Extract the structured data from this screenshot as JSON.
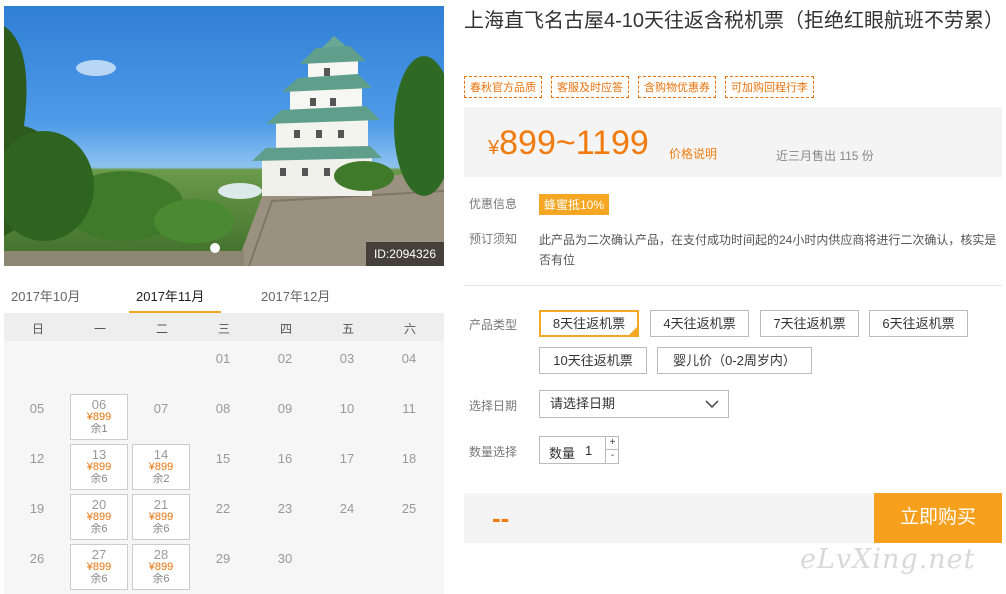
{
  "photo": {
    "id_label": "ID:2094326",
    "alt": "castle-photo"
  },
  "calendar": {
    "months": [
      "2017年10月",
      "2017年11月",
      "2017年12月"
    ],
    "weekdays": [
      "日",
      "一",
      "二",
      "三",
      "四",
      "五",
      "六"
    ],
    "plain_days": [
      "01",
      "02",
      "03",
      "04",
      "05",
      "07",
      "08",
      "09",
      "10",
      "11",
      "12",
      "15",
      "16",
      "17",
      "18",
      "19",
      "22",
      "23",
      "24",
      "25",
      "26",
      "29",
      "30"
    ],
    "available": [
      {
        "day": "06",
        "price": "¥899",
        "stock": "余1"
      },
      {
        "day": "13",
        "price": "¥899",
        "stock": "余6"
      },
      {
        "day": "14",
        "price": "¥899",
        "stock": "余2"
      },
      {
        "day": "20",
        "price": "¥899",
        "stock": "余6"
      },
      {
        "day": "21",
        "price": "¥899",
        "stock": "余6"
      },
      {
        "day": "27",
        "price": "¥899",
        "stock": "余6"
      },
      {
        "day": "28",
        "price": "¥899",
        "stock": "余6"
      }
    ]
  },
  "product": {
    "title": "上海直飞名古屋4-10天往返含税机票（拒绝红眼航班不劳累）",
    "tags": [
      "春秋官方品质",
      "客服及时应答",
      "含购物优惠券",
      "可加购回程行李"
    ],
    "price_currency": "¥",
    "price_range": "899~1199",
    "price_note": "价格说明",
    "sold": "近三月售出 115 份"
  },
  "info": {
    "promo_label": "优惠信息",
    "promo_badge": "蜂蜜抵10%",
    "notice_label": "预订须知",
    "notice_text": "此产品为二次确认产品，在支付成功时间起的24小时内供应商将进行二次确认，核实是否有位"
  },
  "options": {
    "type_label": "产品类型",
    "types": [
      "8天往返机票",
      "4天往返机票",
      "7天往返机票",
      "6天往返机票",
      "10天往返机票",
      "婴儿价（0-2周岁内）"
    ],
    "date_label": "选择日期",
    "date_placeholder": "请选择日期",
    "qty_label": "数量选择",
    "qty_text": "数量",
    "qty_value": "1",
    "qty_plus": "+",
    "qty_minus": "-"
  },
  "purchase": {
    "total": "--",
    "buy_label": "立即购买"
  },
  "watermark": "eLvXing.net",
  "colors": {
    "accent": "#f5a623",
    "price": "#f07c10"
  }
}
